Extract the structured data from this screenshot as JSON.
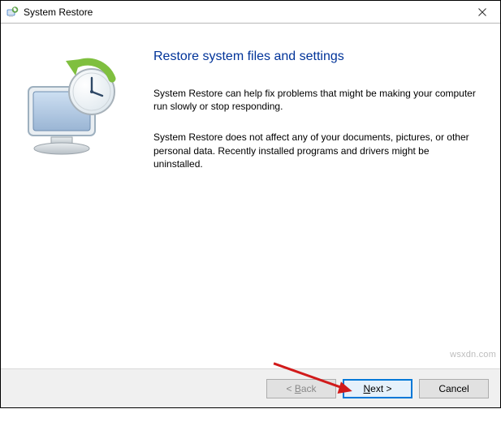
{
  "window": {
    "title": "System Restore"
  },
  "content": {
    "heading": "Restore system files and settings",
    "paragraph1": "System Restore can help fix problems that might be making your computer run slowly or stop responding.",
    "paragraph2": "System Restore does not affect any of your documents, pictures, or other personal data. Recently installed programs and drivers might be uninstalled."
  },
  "buttons": {
    "back_prefix": "< ",
    "back_key": "B",
    "back_rest": "ack",
    "next_key": "N",
    "next_rest": "ext >",
    "cancel": "Cancel"
  },
  "watermark": "wsxdn.com",
  "icons": {
    "app_icon": "system-restore-icon",
    "close_icon": "close-icon"
  }
}
